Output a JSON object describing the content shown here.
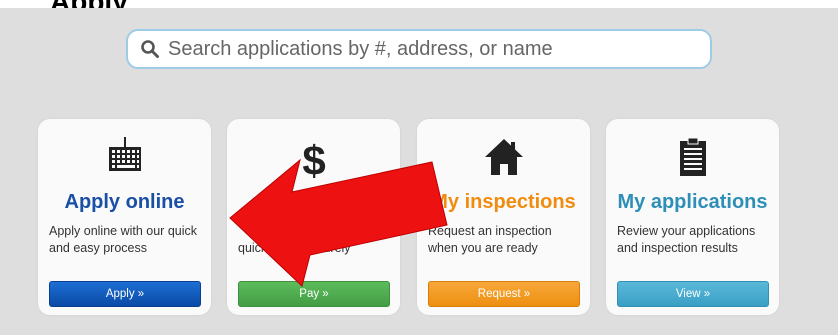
{
  "header": {
    "title": "Apply"
  },
  "search": {
    "placeholder": "Search applications by #, address, or name",
    "icon": "search-icon"
  },
  "colors": {
    "apply_title": "#1a4fa8",
    "inspections_title": "#f08c10",
    "applications_title": "#2d8fb8",
    "arrow": "#ee1111"
  },
  "cards": [
    {
      "icon": "keyboard-icon",
      "title": "Apply online",
      "desc_line1": "Apply online with our quick",
      "desc_line2": "and easy process",
      "button": "Apply »"
    },
    {
      "icon": "dollar-icon",
      "title": "",
      "desc_line1": "",
      "desc_line2": "quickly and securely",
      "button": "Pay »"
    },
    {
      "icon": "house-icon",
      "title": "My inspections",
      "desc_line1": "Request an inspection",
      "desc_line2": "when you are ready",
      "button": "Request »"
    },
    {
      "icon": "clipboard-icon",
      "title": "My applications",
      "desc_line1": "Review your applications",
      "desc_line2": "and inspection results",
      "button": "View »"
    }
  ]
}
